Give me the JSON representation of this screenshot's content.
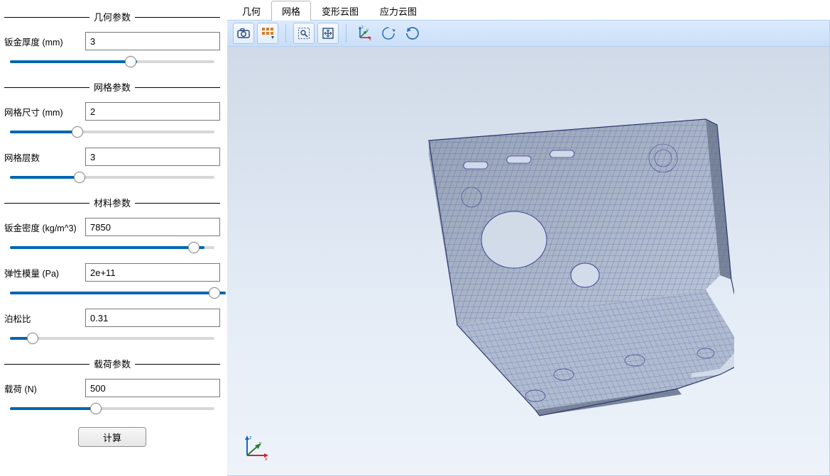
{
  "sections": {
    "geometry": {
      "title": "几何参数",
      "thickness": {
        "label": "钣金厚度 (mm)",
        "value": "3",
        "slider_percent": 59
      }
    },
    "mesh": {
      "title": "网格参数",
      "size": {
        "label": "网格尺寸 (mm)",
        "value": "2",
        "slider_percent": 33
      },
      "layers": {
        "label": "网格层数",
        "value": "3",
        "slider_percent": 34
      }
    },
    "material": {
      "title": "材料参数",
      "density": {
        "label": "钣金密度 (kg/m^3)",
        "value": "7850",
        "slider_percent": 90
      },
      "modulus": {
        "label": "弹性模量 (Pa)",
        "value": "2e+11",
        "slider_percent": 100
      },
      "poisson": {
        "label": "泊松比",
        "value": "0.31",
        "slider_percent": 11
      }
    },
    "load": {
      "title": "载荷参数",
      "force": {
        "label": "载荷 (N)",
        "value": "500",
        "slider_percent": 42
      }
    }
  },
  "compute_label": "计算",
  "tabs": [
    {
      "id": "geom",
      "label": "几何",
      "active": false
    },
    {
      "id": "mesh",
      "label": "网格",
      "active": true
    },
    {
      "id": "disp",
      "label": "变形云图",
      "active": false
    },
    {
      "id": "stress",
      "label": "应力云图",
      "active": false
    }
  ],
  "toolbar": {
    "icons": [
      "camera-icon",
      "options-icon",
      "zoom-area-icon",
      "fit-all-icon",
      "axes-icon",
      "rotate-icon",
      "reset-view-icon"
    ]
  },
  "triad": {
    "x": "x",
    "y": "y",
    "z": "z",
    "colors": {
      "x": "#c62828",
      "y": "#2e7d32",
      "z": "#1565c0"
    }
  }
}
